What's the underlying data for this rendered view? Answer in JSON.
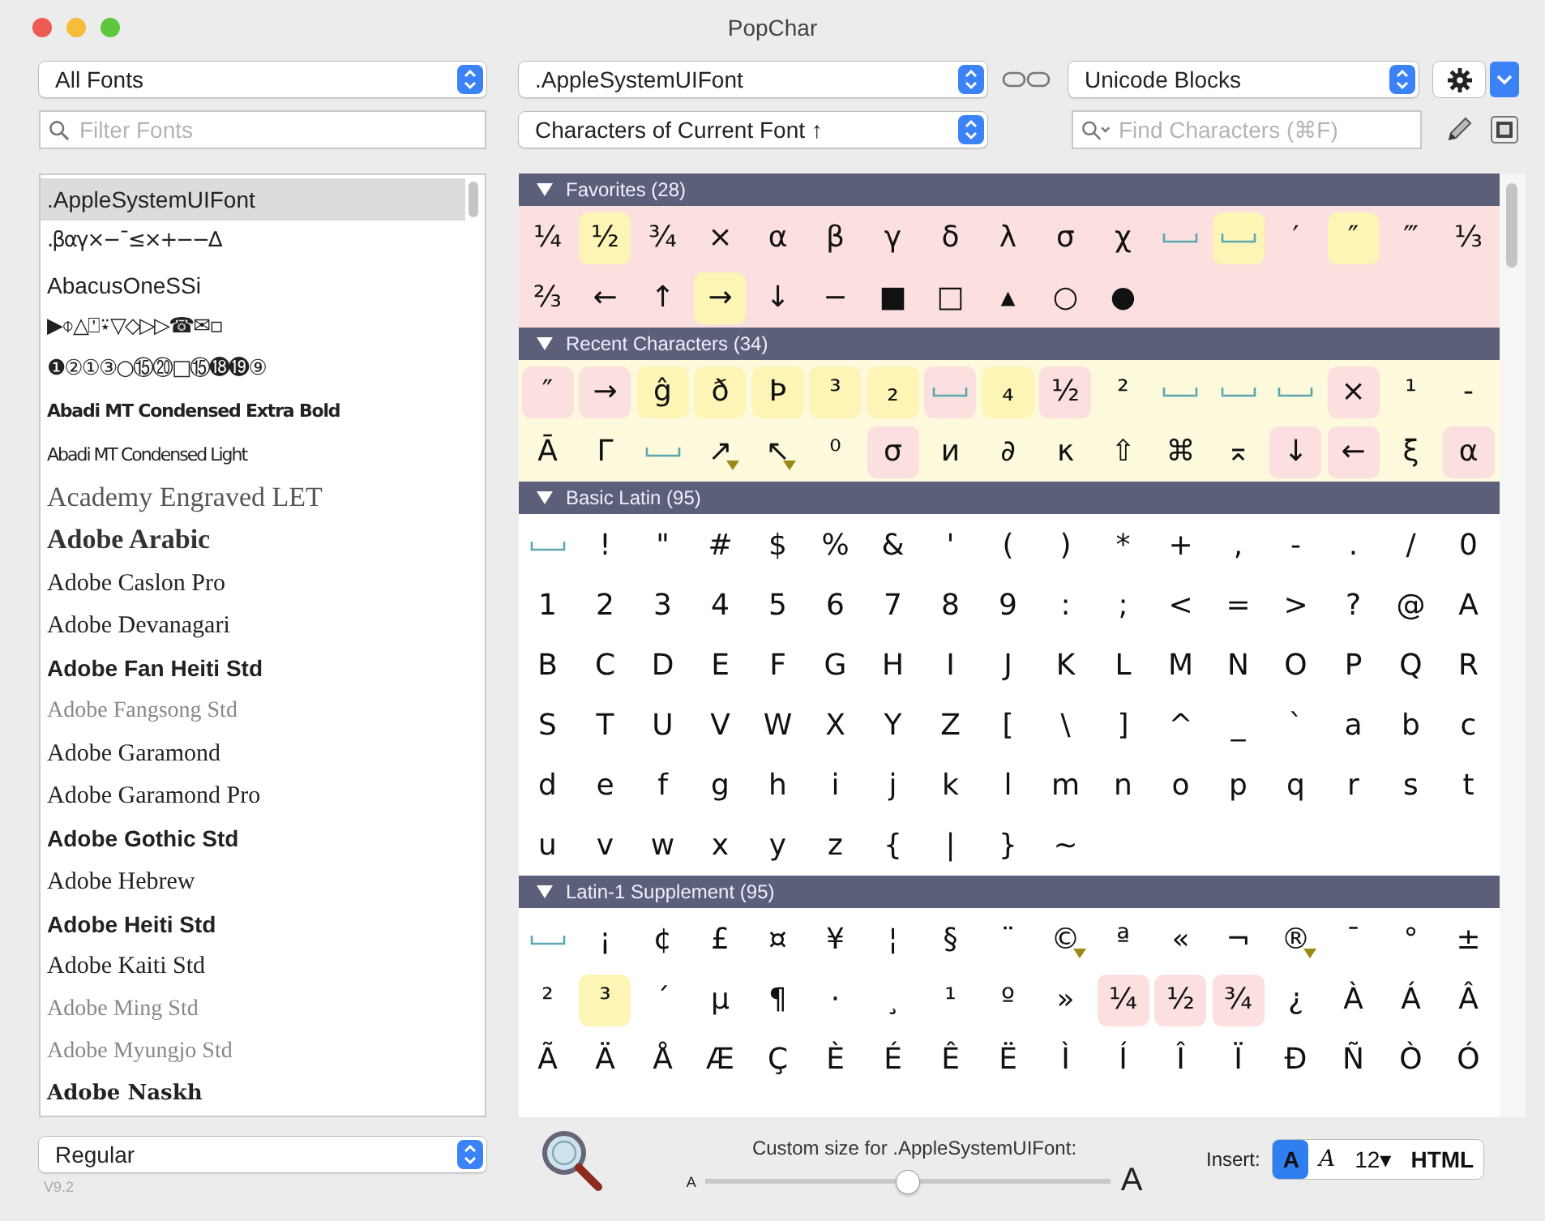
{
  "window": {
    "title": "PopChar"
  },
  "font_filter": {
    "value": "All Fonts"
  },
  "font_search": {
    "placeholder": "Filter Fonts"
  },
  "current_font": {
    "value": ".AppleSystemUIFont"
  },
  "view_mode": {
    "value": "Characters of Current Font ↑"
  },
  "grouping": {
    "value": "Unicode Blocks"
  },
  "char_search": {
    "placeholder": "Find Characters (⌘F)"
  },
  "fonts": [
    {
      "name": ".AppleSystemUIFont",
      "kind": "sans",
      "selected": true
    },
    {
      "name": ".βαγ×−¯≤×+−−∆",
      "kind": "symbol",
      "selected": false
    },
    {
      "name": "AbacusOneSSi",
      "kind": "sans",
      "selected": false
    },
    {
      "name": "▶⌽△⍞⍣▽◇▷▷☎✉▫",
      "kind": "symbol",
      "selected": false
    },
    {
      "name": "❶②①③○⑮⑳□⑮⓲⓳⑨",
      "kind": "symbol",
      "selected": false
    },
    {
      "name": "Abadi MT Condensed Extra Bold",
      "kind": "condensedbold",
      "selected": false
    },
    {
      "name": "Abadi MT Condensed Light",
      "kind": "condensedlight",
      "selected": false
    },
    {
      "name": "Academy Engraved LET",
      "kind": "engraved",
      "selected": false
    },
    {
      "name": "Adobe Arabic",
      "kind": "heavyserif",
      "selected": false
    },
    {
      "name": "Adobe Caslon Pro",
      "kind": "serif",
      "selected": false
    },
    {
      "name": "Adobe Devanagari",
      "kind": "serif",
      "selected": false
    },
    {
      "name": "Adobe Fan Heiti Std",
      "kind": "boldsans",
      "selected": false
    },
    {
      "name": "Adobe Fangsong Std",
      "kind": "lightserif",
      "selected": false
    },
    {
      "name": "Adobe Garamond",
      "kind": "serif",
      "selected": false
    },
    {
      "name": "Adobe Garamond Pro",
      "kind": "serif",
      "selected": false
    },
    {
      "name": "Adobe Gothic Std",
      "kind": "boldsans",
      "selected": false
    },
    {
      "name": "Adobe Hebrew",
      "kind": "serif",
      "selected": false
    },
    {
      "name": "Adobe Heiti Std",
      "kind": "boldsans",
      "selected": false
    },
    {
      "name": "Adobe Kaiti Std",
      "kind": "serif",
      "selected": false
    },
    {
      "name": "Adobe Ming Std",
      "kind": "lightserif",
      "selected": false
    },
    {
      "name": "Adobe Myungjo Std",
      "kind": "lightserif",
      "selected": false
    },
    {
      "name": "Adobe Naskh",
      "kind": "boldserif",
      "selected": false
    }
  ],
  "sections": [
    {
      "title": "Favorites (28)",
      "expanded": true,
      "color": "#fcdfdf",
      "cells": [
        {
          "c": "¼"
        },
        {
          "c": "½",
          "color": "#fcf5b5"
        },
        {
          "c": "¾"
        },
        {
          "c": "×"
        },
        {
          "c": "α"
        },
        {
          "c": "β"
        },
        {
          "c": "γ"
        },
        {
          "c": "δ"
        },
        {
          "c": "λ"
        },
        {
          "c": "σ"
        },
        {
          "c": "χ"
        },
        {
          "kind": "space"
        },
        {
          "kind": "space",
          "color": "#fcf5b5"
        },
        {
          "c": "′"
        },
        {
          "c": "″",
          "color": "#fcf5b5"
        },
        {
          "c": "‴"
        },
        {
          "c": "⅓"
        },
        {
          "c": "⅔"
        },
        {
          "c": "←"
        },
        {
          "c": "↑"
        },
        {
          "c": "→",
          "color": "#fcf5b5"
        },
        {
          "c": "↓"
        },
        {
          "c": "−"
        },
        {
          "c": "■"
        },
        {
          "c": "□"
        },
        {
          "c": "▴"
        },
        {
          "c": "○"
        },
        {
          "c": "●"
        }
      ]
    },
    {
      "title": "Recent Characters (34)",
      "expanded": true,
      "color": "#fdf9dc",
      "cells": [
        {
          "c": "″",
          "color": "#fcdfdf"
        },
        {
          "c": "→",
          "color": "#fcdfdf"
        },
        {
          "c": "ĝ",
          "color": "#fcf5b5"
        },
        {
          "c": "ð",
          "color": "#fcf5b5"
        },
        {
          "c": "Þ",
          "color": "#fcf5b5"
        },
        {
          "c": "³",
          "color": "#fcf5b5"
        },
        {
          "c": "₂",
          "color": "#fcf5b5"
        },
        {
          "kind": "space",
          "color": "#fcdfdf"
        },
        {
          "c": "₄",
          "color": "#fcf5b5"
        },
        {
          "c": "½",
          "color": "#fcdfdf"
        },
        {
          "c": "²"
        },
        {
          "kind": "space"
        },
        {
          "kind": "space"
        },
        {
          "kind": "space"
        },
        {
          "c": "×",
          "color": "#fcdfdf"
        },
        {
          "c": "¹"
        },
        {
          "c": "-"
        },
        {
          "c": "Ā"
        },
        {
          "c": "Γ"
        },
        {
          "kind": "space"
        },
        {
          "c": "↗",
          "variants": true
        },
        {
          "c": "↖",
          "variants": true
        },
        {
          "c": "⁰"
        },
        {
          "c": "σ",
          "color": "#fcdfdf"
        },
        {
          "c": "и"
        },
        {
          "c": "∂"
        },
        {
          "c": "κ"
        },
        {
          "c": "⇧"
        },
        {
          "c": "⌘"
        },
        {
          "c": "⌅"
        },
        {
          "c": "↓",
          "color": "#fcdfdf"
        },
        {
          "c": "←",
          "color": "#fcdfdf"
        },
        {
          "c": "ξ"
        },
        {
          "c": "α",
          "color": "#fcdfdf"
        }
      ]
    },
    {
      "title": "Basic Latin (95)",
      "expanded": true,
      "color": "#ffffff",
      "cells": [
        {
          "kind": "space"
        },
        {
          "c": "!"
        },
        {
          "c": "\""
        },
        {
          "c": "#"
        },
        {
          "c": "$"
        },
        {
          "c": "%"
        },
        {
          "c": "&"
        },
        {
          "c": "'"
        },
        {
          "c": "("
        },
        {
          "c": ")"
        },
        {
          "c": "*"
        },
        {
          "c": "+"
        },
        {
          "c": ","
        },
        {
          "c": "-"
        },
        {
          "c": "."
        },
        {
          "c": "/"
        },
        {
          "c": "0"
        },
        {
          "c": "1"
        },
        {
          "c": "2"
        },
        {
          "c": "3"
        },
        {
          "c": "4"
        },
        {
          "c": "5"
        },
        {
          "c": "6"
        },
        {
          "c": "7"
        },
        {
          "c": "8"
        },
        {
          "c": "9"
        },
        {
          "c": ":"
        },
        {
          "c": ";"
        },
        {
          "c": "<"
        },
        {
          "c": "="
        },
        {
          "c": ">"
        },
        {
          "c": "?"
        },
        {
          "c": "@"
        },
        {
          "c": "A"
        },
        {
          "c": "B"
        },
        {
          "c": "C"
        },
        {
          "c": "D"
        },
        {
          "c": "E"
        },
        {
          "c": "F"
        },
        {
          "c": "G"
        },
        {
          "c": "H"
        },
        {
          "c": "I"
        },
        {
          "c": "J"
        },
        {
          "c": "K"
        },
        {
          "c": "L"
        },
        {
          "c": "M"
        },
        {
          "c": "N"
        },
        {
          "c": "O"
        },
        {
          "c": "P"
        },
        {
          "c": "Q"
        },
        {
          "c": "R"
        },
        {
          "c": "S"
        },
        {
          "c": "T"
        },
        {
          "c": "U"
        },
        {
          "c": "V"
        },
        {
          "c": "W"
        },
        {
          "c": "X"
        },
        {
          "c": "Y"
        },
        {
          "c": "Z"
        },
        {
          "c": "["
        },
        {
          "c": "\\"
        },
        {
          "c": "]"
        },
        {
          "c": "^"
        },
        {
          "c": "_"
        },
        {
          "c": "`"
        },
        {
          "c": "a"
        },
        {
          "c": "b"
        },
        {
          "c": "c"
        },
        {
          "c": "d"
        },
        {
          "c": "e"
        },
        {
          "c": "f"
        },
        {
          "c": "g"
        },
        {
          "c": "h"
        },
        {
          "c": "i"
        },
        {
          "c": "j"
        },
        {
          "c": "k"
        },
        {
          "c": "l"
        },
        {
          "c": "m"
        },
        {
          "c": "n"
        },
        {
          "c": "o"
        },
        {
          "c": "p"
        },
        {
          "c": "q"
        },
        {
          "c": "r"
        },
        {
          "c": "s"
        },
        {
          "c": "t"
        },
        {
          "c": "u"
        },
        {
          "c": "v"
        },
        {
          "c": "w"
        },
        {
          "c": "x"
        },
        {
          "c": "y"
        },
        {
          "c": "z"
        },
        {
          "c": "{"
        },
        {
          "c": "|"
        },
        {
          "c": "}"
        },
        {
          "c": "~"
        }
      ]
    },
    {
      "title": "Latin-1 Supplement (95)",
      "expanded": true,
      "color": "#ffffff",
      "cells": [
        {
          "kind": "space"
        },
        {
          "c": "¡"
        },
        {
          "c": "¢"
        },
        {
          "c": "£"
        },
        {
          "c": "¤"
        },
        {
          "c": "¥"
        },
        {
          "c": "¦"
        },
        {
          "c": "§"
        },
        {
          "c": "¨"
        },
        {
          "c": "©",
          "variants": true
        },
        {
          "c": "ª"
        },
        {
          "c": "«"
        },
        {
          "c": "¬"
        },
        {
          "c": "®",
          "variants": true
        },
        {
          "c": "¯"
        },
        {
          "c": "°"
        },
        {
          "c": "±"
        },
        {
          "c": "²"
        },
        {
          "c": "³",
          "color": "#fcf5b5"
        },
        {
          "c": "´"
        },
        {
          "c": "µ"
        },
        {
          "c": "¶"
        },
        {
          "c": "·"
        },
        {
          "c": "¸"
        },
        {
          "c": "¹"
        },
        {
          "c": "º"
        },
        {
          "c": "»"
        },
        {
          "c": "¼",
          "color": "#fcdfdf"
        },
        {
          "c": "½",
          "color": "#fcdfdf"
        },
        {
          "c": "¾",
          "color": "#fcdfdf"
        },
        {
          "c": "¿"
        },
        {
          "c": "À"
        },
        {
          "c": "Á"
        },
        {
          "c": "Â"
        },
        {
          "c": "Ã"
        },
        {
          "c": "Ä"
        },
        {
          "c": "Å"
        },
        {
          "c": "Æ"
        },
        {
          "c": "Ç"
        },
        {
          "c": "È"
        },
        {
          "c": "É"
        },
        {
          "c": "Ê"
        },
        {
          "c": "Ë"
        },
        {
          "c": "Ì"
        },
        {
          "c": "Í"
        },
        {
          "c": "Î"
        },
        {
          "c": "Ï"
        },
        {
          "c": "Ð"
        },
        {
          "c": "Ñ"
        },
        {
          "c": "Ò"
        },
        {
          "c": "Ó"
        }
      ]
    }
  ],
  "style_menu": {
    "value": "Regular"
  },
  "version": "V9.2",
  "size_slider": {
    "label": "Custom size for .AppleSystemUIFont:",
    "small_label": "A",
    "large_label": "A",
    "level": 0.5
  },
  "insert": {
    "label": "Insert:",
    "options": [
      {
        "label": "A",
        "kind": "plain",
        "selected": true
      },
      {
        "label": "A",
        "kind": "script",
        "selected": false
      },
      {
        "label": "12▾",
        "kind": "plain",
        "selected": false
      },
      {
        "label": "HTML",
        "kind": "plain",
        "selected": false
      }
    ]
  }
}
